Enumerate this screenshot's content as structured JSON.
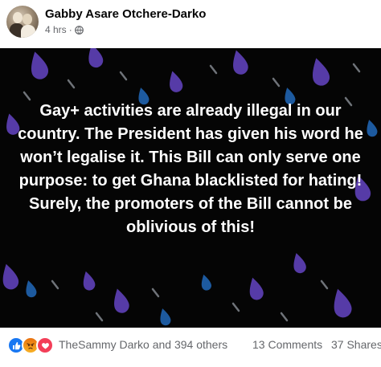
{
  "post": {
    "author": "Gabby Asare Otchere-Darko",
    "time": "4 hrs",
    "separator": "·",
    "privacy_icon": "globe-icon",
    "image_text": "Gay+ activities are already illegal in our country. The President has given his word he won’t legalise it. This Bill can only serve one purpose: to get Ghana blacklisted for hating! Surely, the promoters of the Bill cannot be oblivious of this!"
  },
  "footer": {
    "reaction_icons": [
      "like-icon",
      "angry-icon",
      "love-icon"
    ],
    "reaction_names": "TheSammy Darko and 394 others",
    "comments": "13 Comments",
    "shares": "37 Shares"
  },
  "colors": {
    "image_background": "#050505",
    "drop_purple": "#5b3fb0",
    "drop_blue": "#1f5fa8",
    "drop_grey": "#8a8f96",
    "like": "#1877f2",
    "love": "#f33e58",
    "angry": "#f7b125"
  }
}
